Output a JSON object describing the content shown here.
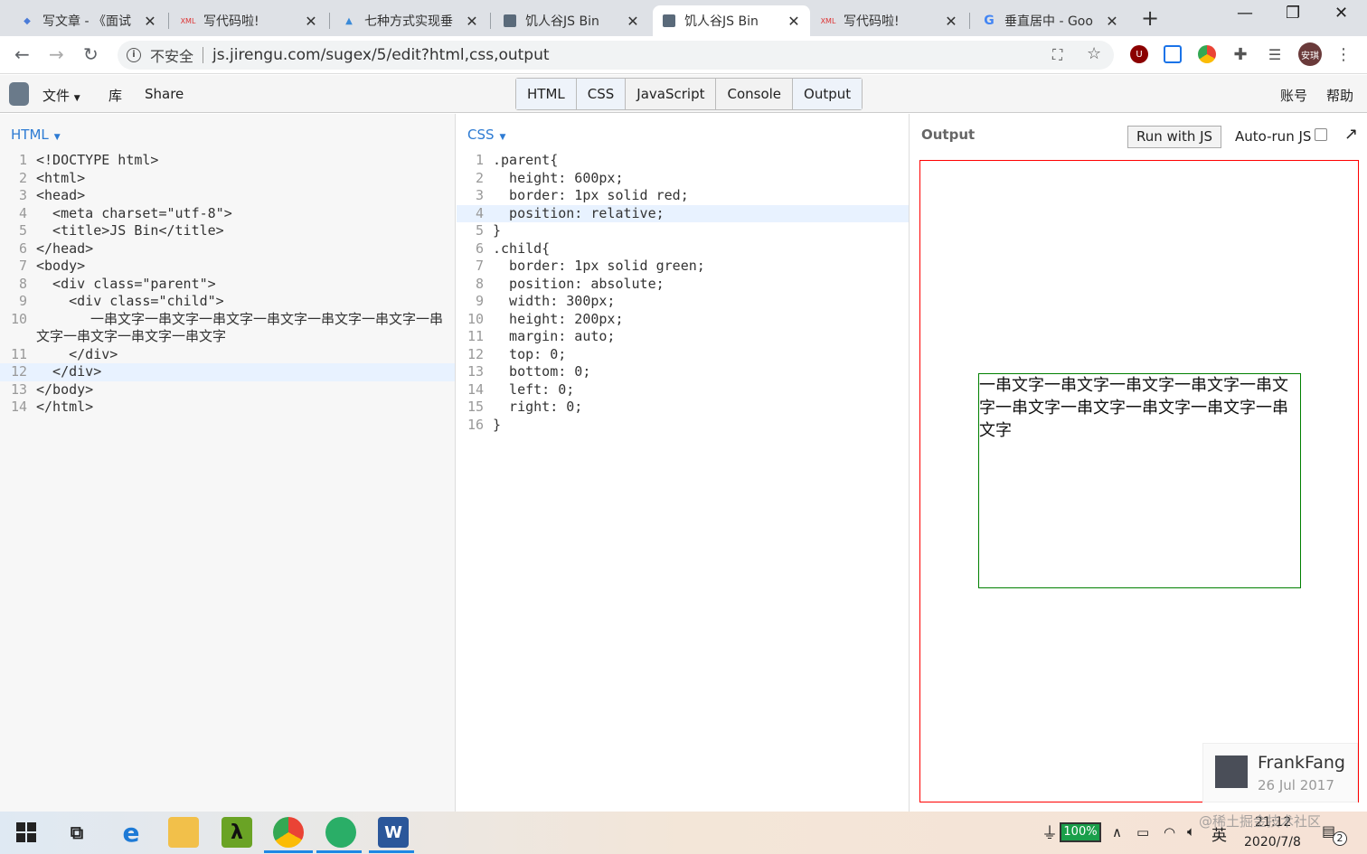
{
  "browser": {
    "tabs": [
      {
        "title": "写文章 - 《面试",
        "favicon": "pen-icon",
        "active": false
      },
      {
        "title": "写代码啦!",
        "favicon": "xml-icon",
        "active": false
      },
      {
        "title": "七种方式实现垂",
        "favicon": "book-icon",
        "active": false
      },
      {
        "title": "饥人谷JS Bin",
        "favicon": "jsbin-icon",
        "active": false
      },
      {
        "title": "饥人谷JS Bin",
        "favicon": "jsbin-icon",
        "active": true
      },
      {
        "title": "写代码啦!",
        "favicon": "xml-icon",
        "active": false
      },
      {
        "title": "垂直居中 - Goo",
        "favicon": "google-icon",
        "active": false
      }
    ],
    "favicon_text": {
      "xml": "XML"
    },
    "close_glyph": "✕",
    "new_tab": "+",
    "window_controls": {
      "minimize": "—",
      "restore": "❐",
      "close": "✕"
    },
    "security_label": "不安全",
    "url": "js.jirengu.com/sugex/5/edit?html,css,output",
    "profile_label": "安琪",
    "extension_u": "U"
  },
  "jsbin": {
    "menu": {
      "file": "文件",
      "library": "库",
      "share": "Share"
    },
    "panel_toggles": [
      "HTML",
      "CSS",
      "JavaScript",
      "Console",
      "Output"
    ],
    "right_menu": {
      "account": "账号",
      "help": "帮助"
    },
    "html_panel": {
      "title": "HTML",
      "lines": [
        {
          "n": "1",
          "text": "<!DOCTYPE html>"
        },
        {
          "n": "2",
          "text": "<html>"
        },
        {
          "n": "3",
          "text": "<head>"
        },
        {
          "n": "4",
          "text": "  <meta charset=\"utf-8\">"
        },
        {
          "n": "5",
          "text": "  <title>JS Bin</title>"
        },
        {
          "n": "6",
          "text": "</head>"
        },
        {
          "n": "7",
          "text": "<body>"
        },
        {
          "n": "8",
          "text": "  <div class=\"parent\">"
        },
        {
          "n": "9",
          "text": "    <div class=\"child\">"
        },
        {
          "n": "10",
          "text": "一串文字一串文字一串文字一串文字一串文字一串文字一串文字一串文字一串文字一串文字"
        },
        {
          "n": "11",
          "text": "    </div>"
        },
        {
          "n": "12",
          "text": "  </div>"
        },
        {
          "n": "13",
          "text": "</body>"
        },
        {
          "n": "14",
          "text": "</html>"
        }
      ]
    },
    "css_panel": {
      "title": "CSS",
      "lines": [
        {
          "n": "1",
          "text": ".parent{"
        },
        {
          "n": "2",
          "text": "  height: 600px;"
        },
        {
          "n": "3",
          "text": "  border: 1px solid red;"
        },
        {
          "n": "4",
          "text": "  position: relative;"
        },
        {
          "n": "5",
          "text": "}"
        },
        {
          "n": "6",
          "text": ".child{"
        },
        {
          "n": "7",
          "text": "  border: 1px solid green;"
        },
        {
          "n": "8",
          "text": "  position: absolute;"
        },
        {
          "n": "9",
          "text": "  width: 300px;"
        },
        {
          "n": "10",
          "text": "  height: 200px;"
        },
        {
          "n": "11",
          "text": "  margin: auto;"
        },
        {
          "n": "12",
          "text": "  top: 0;"
        },
        {
          "n": "13",
          "text": "  bottom: 0;"
        },
        {
          "n": "14",
          "text": "  left: 0;"
        },
        {
          "n": "15",
          "text": "  right: 0;"
        },
        {
          "n": "16",
          "text": "}"
        }
      ]
    },
    "output_panel": {
      "title": "Output",
      "run_button": "Run with JS",
      "autorun_label": "Auto-run JS",
      "autorun_checked": false,
      "popout_glyph": "↗",
      "child_text": "一串文字一串文字一串文字一串文字一串文字一串文字一串文字一串文字一串文字一串文字"
    },
    "author": {
      "name": "FrankFang",
      "date": "26 Jul 2017"
    }
  },
  "taskbar": {
    "battery": "100%",
    "ime": "英",
    "time": "21:12",
    "date": "2020/7/8",
    "notifications": "2",
    "watermark": "@稀土掘金技术社区"
  },
  "colors": {
    "accent": "#2d7bd3",
    "parent_border": "#ff0000",
    "child_border": "#008000"
  }
}
